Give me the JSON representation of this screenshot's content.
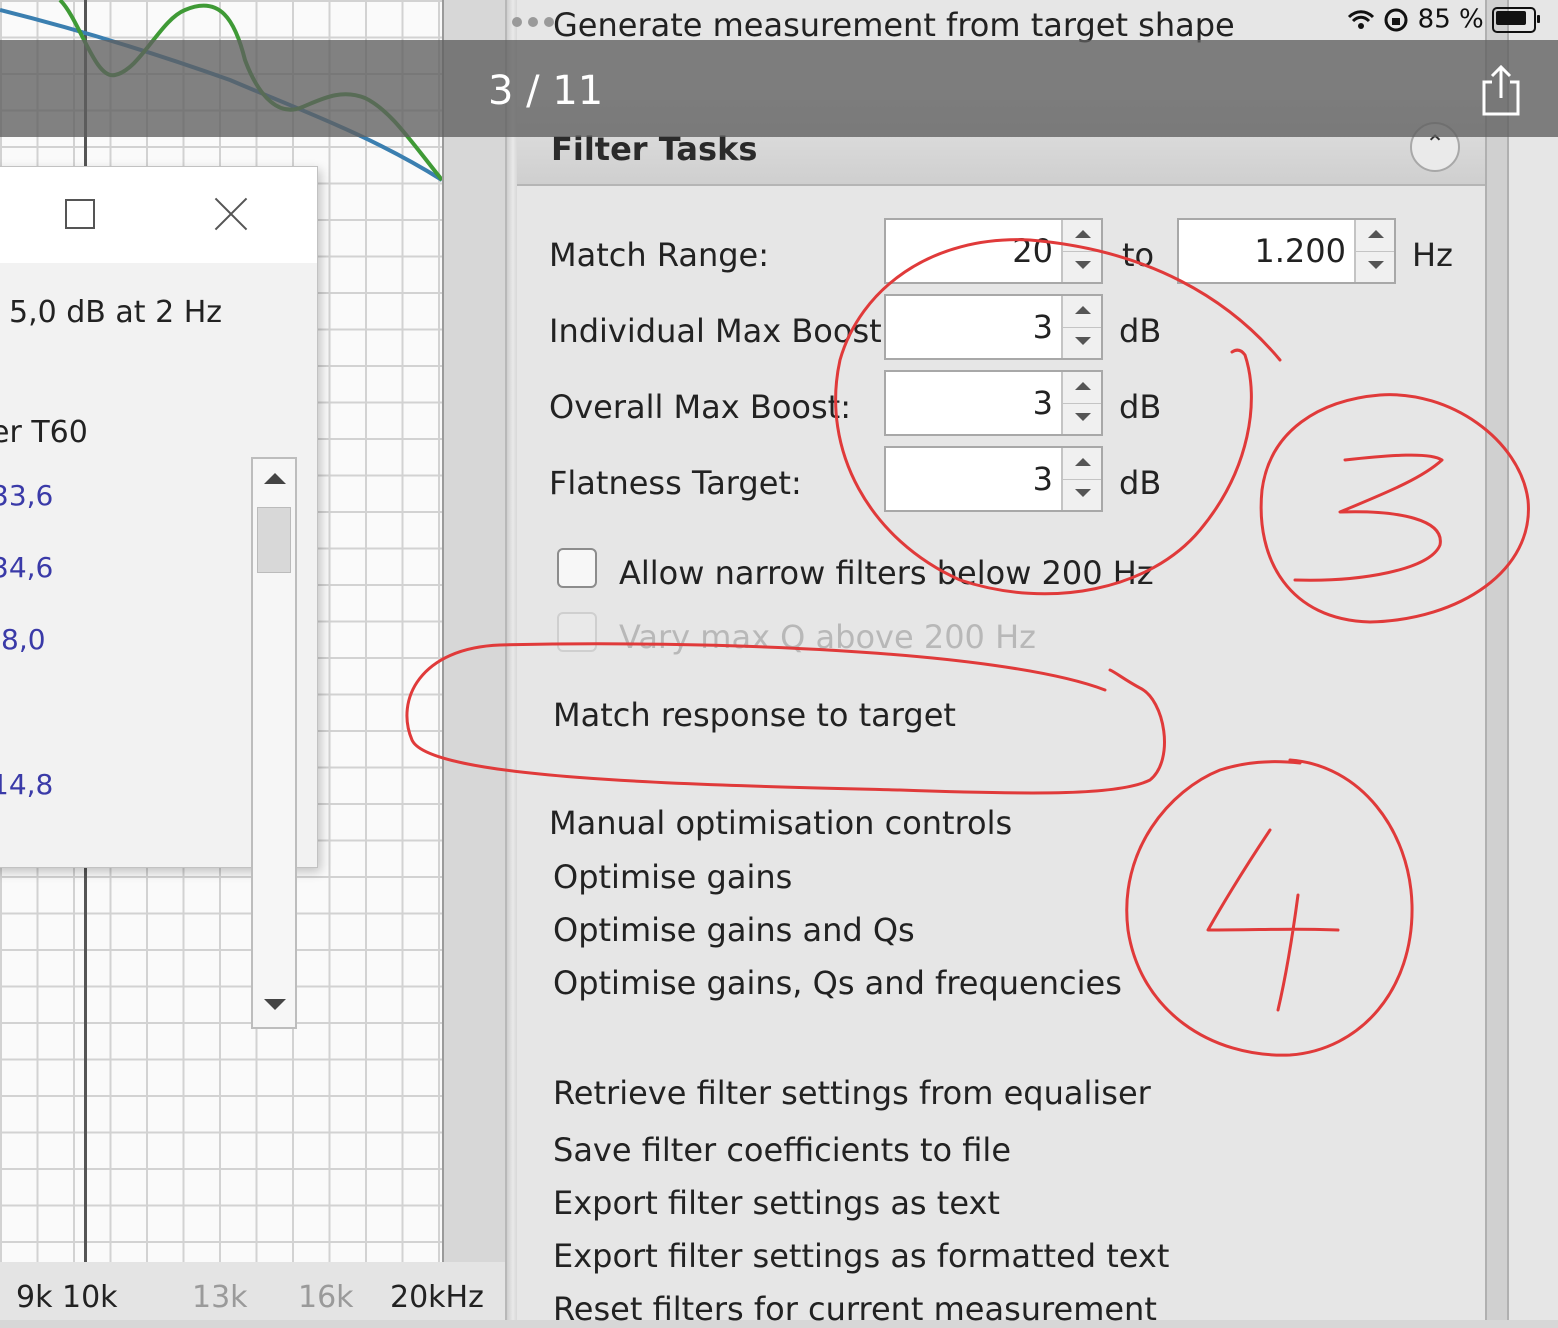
{
  "statusbar": {
    "battery_percent": "85 %",
    "icons": [
      "wifi-icon",
      "rotation-lock-icon",
      "battery-icon"
    ]
  },
  "viewer": {
    "counter": "3 / 11",
    "share_icon": "share-icon"
  },
  "graph": {
    "x_ticks": [
      {
        "label": "9k",
        "minor": false
      },
      {
        "label": "10k",
        "minor": false
      },
      {
        "label": "13k",
        "minor": true
      },
      {
        "label": "16k",
        "minor": true
      },
      {
        "label": "20kHz",
        "minor": false
      }
    ],
    "curve_colors": {
      "green": "#3f9a36",
      "blue": "#3b7fb0"
    }
  },
  "dialog": {
    "line1": "5,0 dB at 2 Hz",
    "column_header": "er T60",
    "values": [
      "33,6",
      "34,6",
      "8,0",
      "14,8"
    ]
  },
  "panel": {
    "top_link": "Generate measurement from target shape",
    "section_title": "Filter Tasks",
    "match_range": {
      "label": "Match Range:",
      "from": "20",
      "to_label": "to",
      "to": "1.200",
      "unit": "Hz"
    },
    "individual_max_boost": {
      "label": "Individual Max Boost:",
      "value": "3",
      "unit": "dB"
    },
    "overall_max_boost": {
      "label": "Overall Max Boost:",
      "value": "3",
      "unit": "dB"
    },
    "flatness_target": {
      "label": "Flatness Target:",
      "value": "3",
      "unit": "dB"
    },
    "allow_narrow": "Allow narrow filters below 200 Hz",
    "vary_max_q": "Vary max Q above 200 Hz",
    "match_response": "Match response to target",
    "manual_heading": "Manual optimisation controls",
    "optimise": [
      "Optimise gains",
      "Optimise gains and Qs",
      "Optimise gains, Qs and frequencies"
    ],
    "retrieve": "Retrieve filter settings from equaliser",
    "actions": [
      "Save filter coefficients to file",
      "Export filter settings as text",
      "Export filter settings as formatted text",
      "Reset filters for current measurement"
    ]
  },
  "annotations": {
    "labels": [
      "3",
      "4"
    ],
    "color": "#e03a3a"
  }
}
